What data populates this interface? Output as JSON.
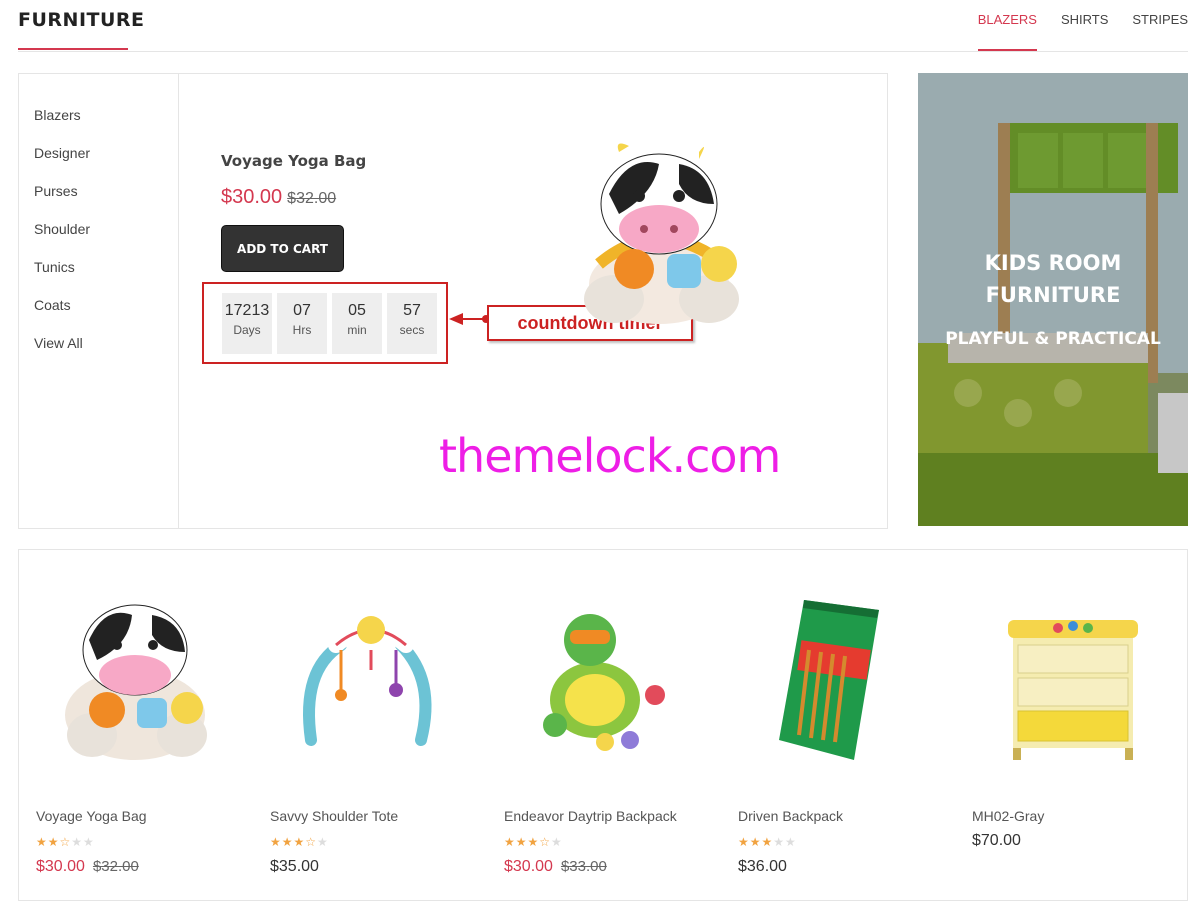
{
  "header": {
    "brand": "FURNITURE",
    "tabs": [
      {
        "label": "BLAZERS",
        "active": true
      },
      {
        "label": "SHIRTS",
        "active": false
      },
      {
        "label": "STRIPES",
        "active": false
      }
    ]
  },
  "sidebar": {
    "items": [
      "Blazers",
      "Designer",
      "Purses",
      "Shoulder",
      "Tunics",
      "Coats",
      "View All"
    ]
  },
  "deal": {
    "name": "Voyage Yoga Bag",
    "price": "$30.00",
    "old_price": "$32.00",
    "add_to_cart": "ADD TO CART",
    "countdown": [
      {
        "value": "17213",
        "label": "Days"
      },
      {
        "value": "07",
        "label": "Hrs"
      },
      {
        "value": "05",
        "label": "min"
      },
      {
        "value": "57",
        "label": "secs"
      }
    ],
    "callout": "countdown timer"
  },
  "watermark": "themelock.com",
  "banner": {
    "line1": "KIDS ROOM",
    "line2": "FURNITURE",
    "line3": "PLAYFUL & PRACTICAL"
  },
  "products": [
    {
      "name": "Voyage Yoga Bag",
      "rating": 2.5,
      "price": "$30.00",
      "old_price": "$32.00",
      "image": "cow-plush-toy"
    },
    {
      "name": "Savvy Shoulder Tote",
      "rating": 3.5,
      "price": "$35.00",
      "old_price": "",
      "image": "baby-play-gym"
    },
    {
      "name": "Endeavor Daytrip Backpack",
      "rating": 3.5,
      "price": "$30.00",
      "old_price": "$33.00",
      "image": "turtle-bath-toy"
    },
    {
      "name": "Driven Backpack",
      "rating": 3,
      "price": "$36.00",
      "old_price": "",
      "image": "pretz-snack-box"
    },
    {
      "name": "MH02-Gray",
      "rating": 0,
      "price": "$70.00",
      "old_price": "",
      "image": "yellow-dresser"
    }
  ],
  "colors": {
    "accent": "#d4384f",
    "callout_red": "#cc2222",
    "watermark": "#ee1ee6",
    "star": "#f1a341"
  }
}
